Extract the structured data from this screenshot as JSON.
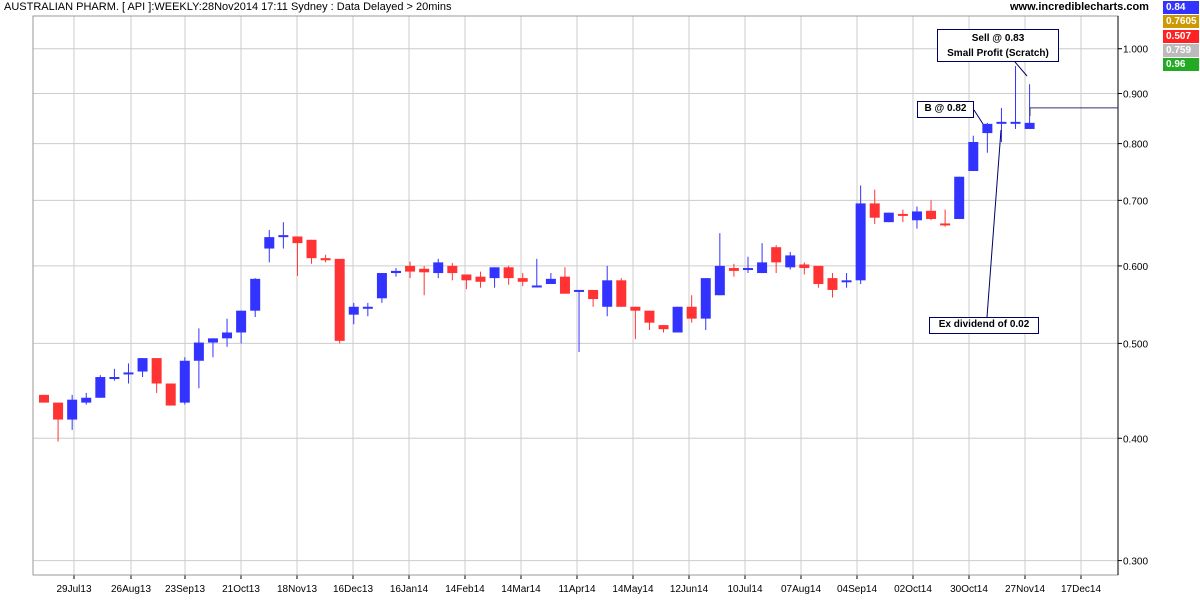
{
  "header": {
    "title": "AUSTRALIAN PHARM. [ API ]:WEEKLY:28Nov2014 17:11 Sydney : Data Delayed > 20mins",
    "site": "www.incrediblecharts.com"
  },
  "badges": [
    {
      "text": "0.84",
      "color": "#3333ff"
    },
    {
      "text": "0.7605",
      "color": "#cc9900"
    },
    {
      "text": "0.507",
      "color": "#ff2222"
    },
    {
      "text": "0.759",
      "color": "#bbbbbb"
    },
    {
      "text": "0.96",
      "color": "#22aa22"
    }
  ],
  "annotations": {
    "sell_line1": "Sell @ 0.83",
    "sell_line2": "Small Profit (Scratch)",
    "buy": "B @ 0.82",
    "dividend": "Ex dividend of 0.02"
  },
  "colors": {
    "up": "#3333ff",
    "down": "#ff3333",
    "grid": "#cccccc",
    "axis": "#000000"
  },
  "chart_data": {
    "type": "candlestick",
    "scale": "log",
    "ylim": [
      0.29,
      1.08
    ],
    "y_ticks": [
      0.3,
      0.4,
      0.5,
      0.6,
      0.7,
      0.8,
      0.9,
      1.0
    ],
    "y_tick_labels": [
      "0.300",
      "0.400",
      "0.500",
      "0.600",
      "0.700",
      "0.800",
      "0.900",
      "1.000"
    ],
    "x_tick_labels": [
      "29Jul13",
      "26Aug13",
      "23Sep13",
      "21Oct13",
      "18Nov13",
      "16Dec13",
      "16Jan14",
      "14Feb14",
      "14Mar14",
      "11Apr14",
      "14May14",
      "12Jun14",
      "10Jul14",
      "07Aug14",
      "04Sep14",
      "02Oct14",
      "30Oct14",
      "27Nov14",
      "17Dec14"
    ],
    "week_ending_price_line": 0.87,
    "candles": [
      {
        "o": 0.443,
        "h": 0.443,
        "l": 0.435,
        "c": 0.435
      },
      {
        "o": 0.435,
        "h": 0.435,
        "l": 0.397,
        "c": 0.418
      },
      {
        "o": 0.418,
        "h": 0.443,
        "l": 0.408,
        "c": 0.438
      },
      {
        "o": 0.435,
        "h": 0.445,
        "l": 0.433,
        "c": 0.44
      },
      {
        "o": 0.44,
        "h": 0.464,
        "l": 0.44,
        "c": 0.462
      },
      {
        "o": 0.462,
        "h": 0.471,
        "l": 0.458,
        "c": 0.462
      },
      {
        "o": 0.465,
        "h": 0.477,
        "l": 0.455,
        "c": 0.467
      },
      {
        "o": 0.468,
        "h": 0.483,
        "l": 0.462,
        "c": 0.483
      },
      {
        "o": 0.483,
        "h": 0.483,
        "l": 0.445,
        "c": 0.455
      },
      {
        "o": 0.455,
        "h": 0.455,
        "l": 0.432,
        "c": 0.432
      },
      {
        "o": 0.435,
        "h": 0.484,
        "l": 0.433,
        "c": 0.48
      },
      {
        "o": 0.48,
        "h": 0.518,
        "l": 0.45,
        "c": 0.501
      },
      {
        "o": 0.501,
        "h": 0.506,
        "l": 0.484,
        "c": 0.506
      },
      {
        "o": 0.506,
        "h": 0.53,
        "l": 0.496,
        "c": 0.513
      },
      {
        "o": 0.513,
        "h": 0.54,
        "l": 0.5,
        "c": 0.54
      },
      {
        "o": 0.54,
        "h": 0.583,
        "l": 0.532,
        "c": 0.582
      },
      {
        "o": 0.625,
        "h": 0.653,
        "l": 0.605,
        "c": 0.642
      },
      {
        "o": 0.645,
        "h": 0.665,
        "l": 0.625,
        "c": 0.645
      },
      {
        "o": 0.643,
        "h": 0.643,
        "l": 0.586,
        "c": 0.633
      },
      {
        "o": 0.638,
        "h": 0.638,
        "l": 0.603,
        "c": 0.611
      },
      {
        "o": 0.611,
        "h": 0.616,
        "l": 0.605,
        "c": 0.608
      },
      {
        "o": 0.61,
        "h": 0.61,
        "l": 0.5,
        "c": 0.503
      },
      {
        "o": 0.535,
        "h": 0.55,
        "l": 0.523,
        "c": 0.545
      },
      {
        "o": 0.545,
        "h": 0.55,
        "l": 0.533,
        "c": 0.545
      },
      {
        "o": 0.556,
        "h": 0.59,
        "l": 0.55,
        "c": 0.59
      },
      {
        "o": 0.59,
        "h": 0.597,
        "l": 0.585,
        "c": 0.593
      },
      {
        "o": 0.6,
        "h": 0.606,
        "l": 0.583,
        "c": 0.592
      },
      {
        "o": 0.596,
        "h": 0.6,
        "l": 0.56,
        "c": 0.591
      },
      {
        "o": 0.59,
        "h": 0.61,
        "l": 0.583,
        "c": 0.605
      },
      {
        "o": 0.6,
        "h": 0.604,
        "l": 0.58,
        "c": 0.59
      },
      {
        "o": 0.588,
        "h": 0.588,
        "l": 0.568,
        "c": 0.58
      },
      {
        "o": 0.585,
        "h": 0.592,
        "l": 0.57,
        "c": 0.578
      },
      {
        "o": 0.583,
        "h": 0.598,
        "l": 0.57,
        "c": 0.598
      },
      {
        "o": 0.598,
        "h": 0.6,
        "l": 0.574,
        "c": 0.583
      },
      {
        "o": 0.583,
        "h": 0.59,
        "l": 0.572,
        "c": 0.578
      },
      {
        "o": 0.573,
        "h": 0.61,
        "l": 0.573,
        "c": 0.573
      },
      {
        "o": 0.575,
        "h": 0.59,
        "l": 0.575,
        "c": 0.582
      },
      {
        "o": 0.585,
        "h": 0.598,
        "l": 0.562,
        "c": 0.562
      },
      {
        "o": 0.567,
        "h": 0.567,
        "l": 0.49,
        "c": 0.567
      },
      {
        "o": 0.567,
        "h": 0.567,
        "l": 0.545,
        "c": 0.555
      },
      {
        "o": 0.545,
        "h": 0.6,
        "l": 0.533,
        "c": 0.58
      },
      {
        "o": 0.58,
        "h": 0.583,
        "l": 0.545,
        "c": 0.545
      },
      {
        "o": 0.545,
        "h": 0.545,
        "l": 0.505,
        "c": 0.54
      },
      {
        "o": 0.54,
        "h": 0.54,
        "l": 0.516,
        "c": 0.525
      },
      {
        "o": 0.522,
        "h": 0.522,
        "l": 0.513,
        "c": 0.517
      },
      {
        "o": 0.513,
        "h": 0.545,
        "l": 0.513,
        "c": 0.545
      },
      {
        "o": 0.545,
        "h": 0.56,
        "l": 0.525,
        "c": 0.53
      },
      {
        "o": 0.53,
        "h": 0.583,
        "l": 0.516,
        "c": 0.583
      },
      {
        "o": 0.56,
        "h": 0.648,
        "l": 0.56,
        "c": 0.6
      },
      {
        "o": 0.597,
        "h": 0.603,
        "l": 0.585,
        "c": 0.593
      },
      {
        "o": 0.597,
        "h": 0.613,
        "l": 0.59,
        "c": 0.597
      },
      {
        "o": 0.59,
        "h": 0.633,
        "l": 0.59,
        "c": 0.605
      },
      {
        "o": 0.627,
        "h": 0.63,
        "l": 0.59,
        "c": 0.605
      },
      {
        "o": 0.598,
        "h": 0.62,
        "l": 0.595,
        "c": 0.615
      },
      {
        "o": 0.602,
        "h": 0.605,
        "l": 0.588,
        "c": 0.597
      },
      {
        "o": 0.6,
        "h": 0.6,
        "l": 0.57,
        "c": 0.575
      },
      {
        "o": 0.583,
        "h": 0.59,
        "l": 0.557,
        "c": 0.567
      },
      {
        "o": 0.58,
        "h": 0.59,
        "l": 0.57,
        "c": 0.58
      },
      {
        "o": 0.58,
        "h": 0.725,
        "l": 0.575,
        "c": 0.695
      },
      {
        "o": 0.695,
        "h": 0.718,
        "l": 0.662,
        "c": 0.672
      },
      {
        "o": 0.665,
        "h": 0.68,
        "l": 0.665,
        "c": 0.68
      },
      {
        "o": 0.678,
        "h": 0.685,
        "l": 0.665,
        "c": 0.675
      },
      {
        "o": 0.668,
        "h": 0.69,
        "l": 0.655,
        "c": 0.682
      },
      {
        "o": 0.683,
        "h": 0.7,
        "l": 0.668,
        "c": 0.67
      },
      {
        "o": 0.663,
        "h": 0.685,
        "l": 0.658,
        "c": 0.66
      },
      {
        "o": 0.67,
        "h": 0.74,
        "l": 0.67,
        "c": 0.74
      },
      {
        "o": 0.75,
        "h": 0.815,
        "l": 0.75,
        "c": 0.803
      },
      {
        "o": 0.82,
        "h": 0.84,
        "l": 0.783,
        "c": 0.838
      },
      {
        "o": 0.842,
        "h": 0.87,
        "l": 0.803,
        "c": 0.842
      },
      {
        "o": 0.842,
        "h": 0.96,
        "l": 0.828,
        "c": 0.842
      },
      {
        "o": 0.828,
        "h": 0.92,
        "l": 0.828,
        "c": 0.84
      }
    ]
  }
}
